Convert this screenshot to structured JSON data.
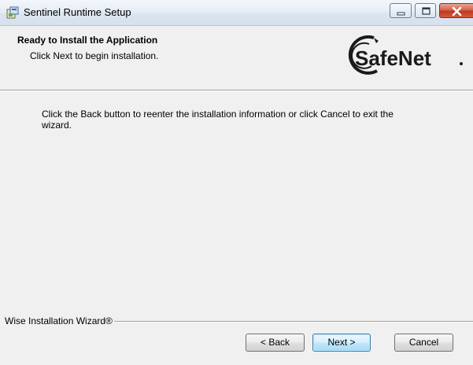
{
  "window": {
    "title": "Sentinel Runtime Setup",
    "controls": [
      "minimize-icon",
      "maximize-icon",
      "close-icon"
    ]
  },
  "header": {
    "title": "Ready to Install the Application",
    "subtitle": "Click Next to begin installation.",
    "logo_text": "SafeNet"
  },
  "body": {
    "message": "Click the Back button to reenter the installation information or click Cancel to exit the wizard."
  },
  "footer": {
    "brand": "Wise Installation Wizard®",
    "buttons": {
      "back": "< Back",
      "next": "Next >",
      "cancel": "Cancel"
    }
  },
  "colors": {
    "close_button": "#c0391f",
    "default_button_border": "#3c7fb1",
    "logo": "#1a1a1a"
  }
}
